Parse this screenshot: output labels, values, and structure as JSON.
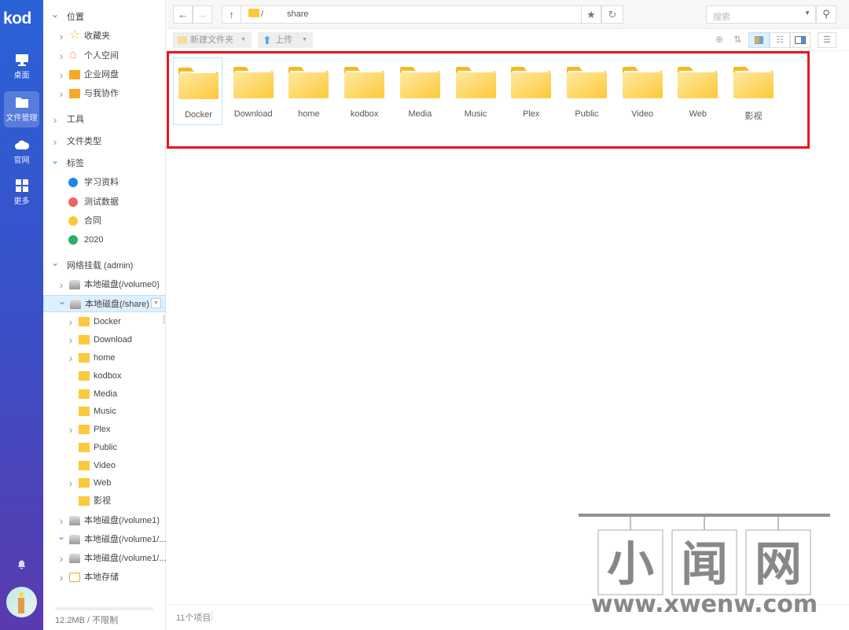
{
  "app": {
    "logo": "kod",
    "accent": "#2c8be8"
  },
  "nav": {
    "items": [
      {
        "label": "桌面",
        "icon": "desktop-icon"
      },
      {
        "label": "文件管理",
        "icon": "folder-icon",
        "active": true
      },
      {
        "label": "官网",
        "icon": "cloud-icon"
      },
      {
        "label": "更多",
        "icon": "grid-icon"
      }
    ]
  },
  "tree": {
    "rows": [
      {
        "label": "位置",
        "arrow": "open",
        "indent": 0,
        "type": "header"
      },
      {
        "label": "收藏夹",
        "arrow": "closed",
        "indent": 1,
        "type": "star"
      },
      {
        "label": "个人空间",
        "arrow": "closed",
        "indent": 1,
        "type": "home"
      },
      {
        "label": "企业网盘",
        "arrow": "closed",
        "indent": 1,
        "type": "orgfolder"
      },
      {
        "label": "与我协作",
        "arrow": "closed",
        "indent": 1,
        "type": "sharefolder"
      },
      {
        "label": "工具",
        "arrow": "closed",
        "indent": 0,
        "type": "header"
      },
      {
        "label": "文件类型",
        "arrow": "closed",
        "indent": 0,
        "type": "header"
      },
      {
        "label": "标签",
        "arrow": "open",
        "indent": 0,
        "type": "header"
      },
      {
        "label": "学习资料",
        "indent": 1,
        "type": "tag",
        "color": "#1a86e6"
      },
      {
        "label": "测试数据",
        "indent": 1,
        "type": "tag",
        "color": "#ee6461"
      },
      {
        "label": "合同",
        "indent": 1,
        "type": "tag",
        "color": "#fcc935"
      },
      {
        "label": "2020",
        "indent": 1,
        "type": "tag",
        "color": "#2dae6a"
      },
      {
        "label": "网络挂载 (admin)",
        "arrow": "open",
        "indent": 0,
        "type": "header"
      },
      {
        "label": "本地磁盘(/volume0)",
        "arrow": "closed",
        "indent": 1,
        "type": "disk"
      },
      {
        "label": "本地磁盘(/share)",
        "arrow": "open",
        "indent": 1,
        "type": "disk",
        "selected": true
      },
      {
        "label": "Docker",
        "arrow": "closed",
        "indent": 2,
        "type": "folder"
      },
      {
        "label": "Download",
        "arrow": "closed",
        "indent": 2,
        "type": "folder"
      },
      {
        "label": "home",
        "arrow": "closed",
        "indent": 2,
        "type": "folder"
      },
      {
        "label": "kodbox",
        "indent": 2,
        "type": "folder"
      },
      {
        "label": "Media",
        "indent": 2,
        "type": "folder"
      },
      {
        "label": "Music",
        "indent": 2,
        "type": "folder"
      },
      {
        "label": "Plex",
        "arrow": "closed",
        "indent": 2,
        "type": "folder"
      },
      {
        "label": "Public",
        "indent": 2,
        "type": "folder"
      },
      {
        "label": "Video",
        "indent": 2,
        "type": "folder"
      },
      {
        "label": "Web",
        "arrow": "closed",
        "indent": 2,
        "type": "folder"
      },
      {
        "label": "影视",
        "indent": 2,
        "type": "folder"
      },
      {
        "label": "本地磁盘(/volume1)",
        "arrow": "closed",
        "indent": 1,
        "type": "disk"
      },
      {
        "label": "本地磁盘(/volume1/....",
        "arrow": "open",
        "indent": 1,
        "type": "disk"
      },
      {
        "label": "本地磁盘(/volume1/....",
        "arrow": "closed",
        "indent": 1,
        "type": "disk"
      },
      {
        "label": "本地存储",
        "arrow": "closed",
        "indent": 1,
        "type": "storage"
      }
    ],
    "storage": "12.2MB / 不限制"
  },
  "toolbar": {
    "path_root": "/",
    "path_current": "share",
    "search_placeholder": "搜索",
    "new_folder": "新建文件夹",
    "upload": "上传"
  },
  "files": [
    "Docker",
    "Download",
    "home",
    "kodbox",
    "Media",
    "Music",
    "Plex",
    "Public",
    "Video",
    "Web",
    "影视"
  ],
  "status": {
    "count": "11个项目"
  },
  "watermark": {
    "text": "小闻网",
    "url": "www.xwenw.com"
  }
}
